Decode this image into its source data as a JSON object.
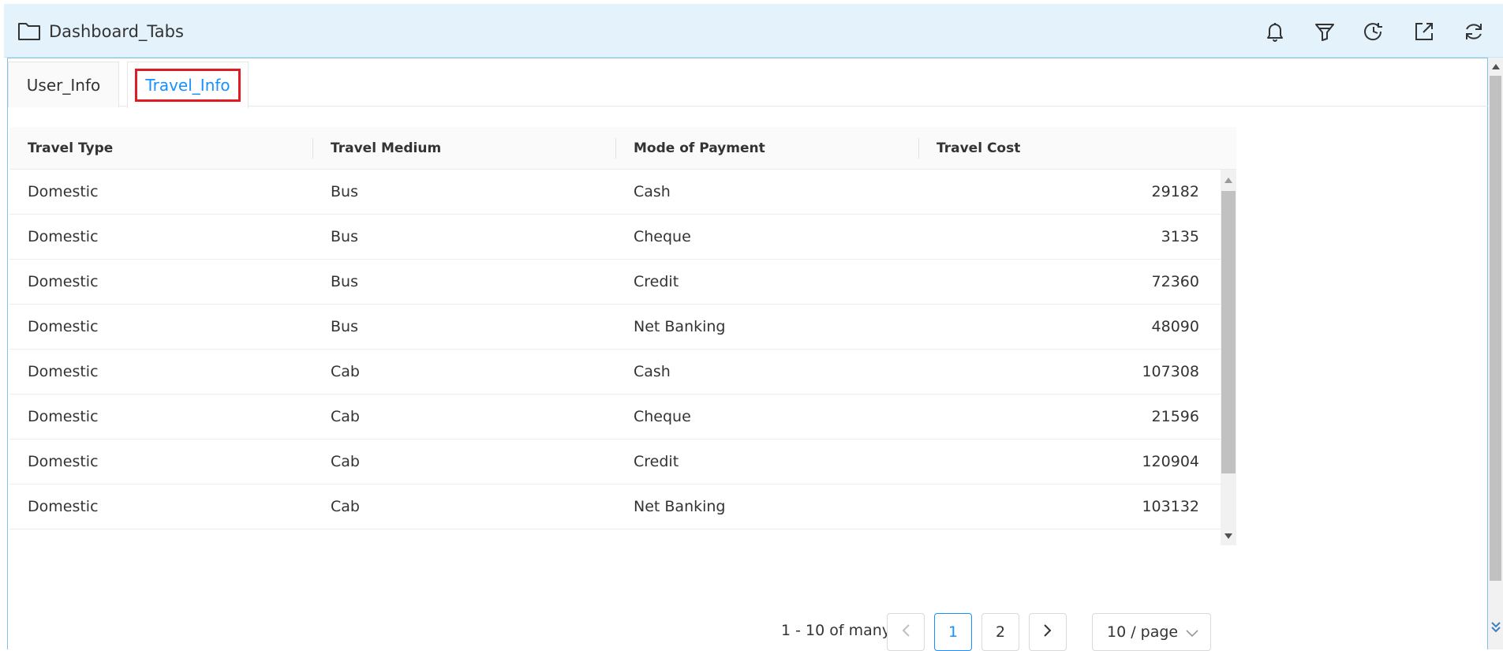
{
  "header": {
    "title": "Dashboard_Tabs",
    "icons": [
      "bell-icon",
      "filter-icon",
      "history-icon",
      "export-icon",
      "refresh-icon"
    ]
  },
  "tabs": [
    {
      "label": "User_Info",
      "active": false
    },
    {
      "label": "Travel_Info",
      "active": true
    }
  ],
  "table": {
    "columns": [
      "Travel Type",
      "Travel Medium",
      "Mode of Payment",
      "Travel Cost"
    ],
    "rows": [
      [
        "Domestic",
        "Bus",
        "Cash",
        "29182"
      ],
      [
        "Domestic",
        "Bus",
        "Cheque",
        "3135"
      ],
      [
        "Domestic",
        "Bus",
        "Credit",
        "72360"
      ],
      [
        "Domestic",
        "Bus",
        "Net Banking",
        "48090"
      ],
      [
        "Domestic",
        "Cab",
        "Cash",
        "107308"
      ],
      [
        "Domestic",
        "Cab",
        "Cheque",
        "21596"
      ],
      [
        "Domestic",
        "Cab",
        "Credit",
        "120904"
      ],
      [
        "Domestic",
        "Cab",
        "Net Banking",
        "103132"
      ]
    ]
  },
  "pagination": {
    "info": "1 - 10 of many",
    "pages": [
      "1",
      "2"
    ],
    "current_page": "1",
    "prev_label": "<",
    "next_label": ">",
    "page_size": "10 / page"
  },
  "colors": {
    "accent": "#1890ff",
    "header_bg": "#e4f3fb",
    "highlight": "#e01b24"
  }
}
